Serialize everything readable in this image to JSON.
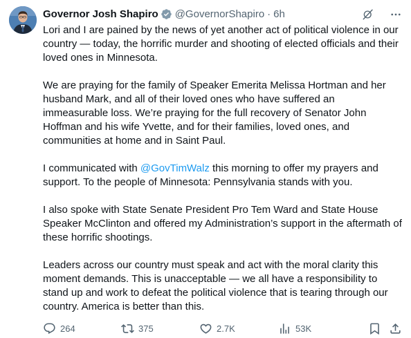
{
  "author": {
    "name": "Governor Josh Shapiro",
    "handle": "@GovernorShapiro",
    "separator": "·",
    "time": "6h",
    "avatar_icon": "person-portrait-icon",
    "verified_color": "#829aab"
  },
  "post": {
    "p1": "Lori and I are pained by the news of yet another act of political violence in our country — today, the horrific murder and shooting of elected officials and their loved ones in Minnesota.",
    "p2": "We are praying for the family of Speaker Emerita Melissa Hortman and her husband Mark, and all of their loved ones who have suffered an immeasurable loss. We’re praying for the full recovery of Senator John Hoffman and his wife Yvette, and for their families, loved ones, and communities at home and in Saint Paul.",
    "p3_before": "I communicated with ",
    "p3_mention": "@GovTimWalz",
    "p3_after": " this morning to offer my prayers and support. To the people of Minnesota: Pennsylvania stands with you.",
    "p4": "I also spoke with State Senate President Pro Tem Ward and State House Speaker McClinton and offered my Administration’s support in the aftermath of these horrific shootings.",
    "p5": "Leaders across our country must speak and act with the moral clarity this moment demands. This is unacceptable — we all have a responsibility to stand up and work to defeat the political violence that is tearing through our country. America is better than this."
  },
  "actions": {
    "replies": "264",
    "reposts": "375",
    "likes": "2.7K",
    "views": "53K"
  },
  "colors": {
    "text": "#0f1419",
    "secondary": "#536471",
    "link": "#1d9bf0"
  }
}
